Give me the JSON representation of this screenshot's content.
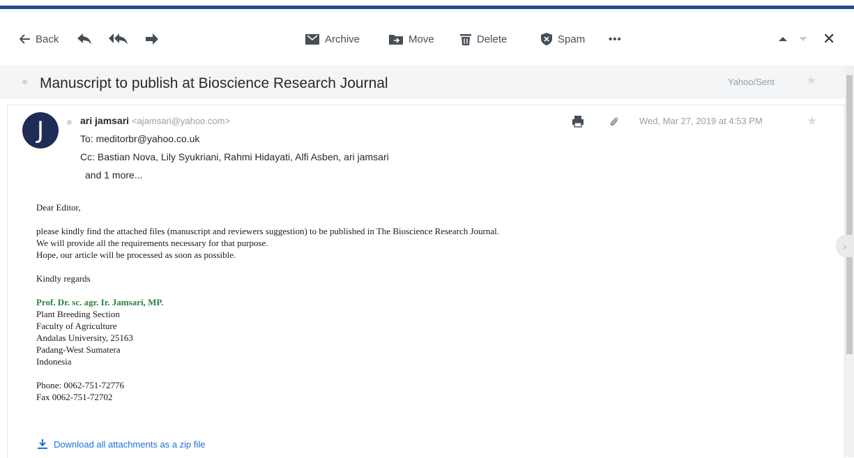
{
  "toolbar": {
    "back_label": "Back",
    "archive_label": "Archive",
    "move_label": "Move",
    "delete_label": "Delete",
    "spam_label": "Spam",
    "more_label": "•••",
    "close_label": "✕"
  },
  "message": {
    "subject": "Manuscript to publish at Bioscience Research Journal",
    "folder": "Yahoo/Sent",
    "avatar_letter": "J",
    "sender_name": "ari jamsari",
    "sender_email": "<ajamsari@yahoo.com>",
    "to": "To: meditorbr@yahoo.co.uk",
    "cc": "Cc: Bastian Nova,  Lily Syukriani,  Rahmi Hidayati,  Alfi Asben,  ari jamsari",
    "cc_more": "and 1 more...",
    "date": "Wed, Mar 27, 2019 at 4:53 PM"
  },
  "body": {
    "greeting": "Dear Editor,",
    "p1": "please kindly find the attached files (manuscript and reviewers suggestion) to be published in The Bioscience Research Journal.",
    "p2": "We will provide all the requirements necessary for that purpose.",
    "p3": "Hope, our article will be processed as soon as possible.",
    "closing": "Kindly regards",
    "sig_name": "Prof. Dr. sc. agr. Ir. Jamsari, MP.",
    "sig_lines": [
      "Plant Breeding Section",
      "Faculty of Agriculture",
      "Andalas University, 25163",
      "Padang-West Sumatera",
      "Indonesia"
    ],
    "phone": "Phone: 0062-751-72776",
    "fax": "Fax 0062-751-72702"
  },
  "attachments": {
    "download_all_label": "Download all attachments as a zip file"
  },
  "side_handle": "›",
  "colors": {
    "accent_band": "#1f4e8c",
    "avatar_bg": "#1d2d55",
    "signature_name": "#2a7f3c",
    "link": "#1e6fd9"
  }
}
